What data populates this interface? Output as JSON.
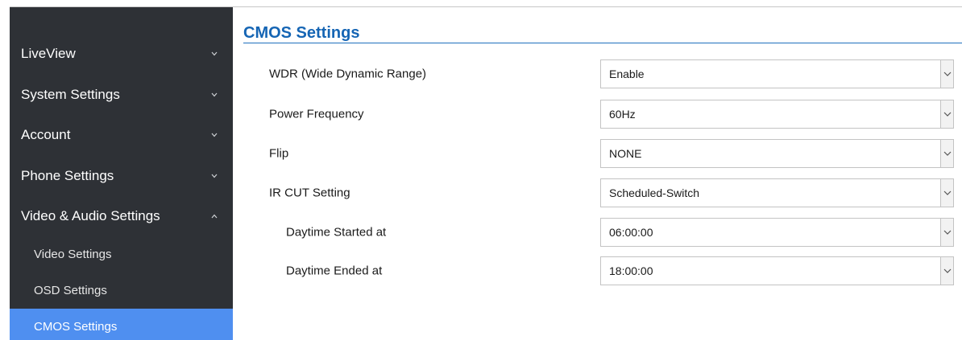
{
  "sidebar": {
    "items": [
      {
        "label": "LiveView",
        "expanded": false
      },
      {
        "label": "System Settings",
        "expanded": false
      },
      {
        "label": "Account",
        "expanded": false
      },
      {
        "label": "Phone Settings",
        "expanded": false
      },
      {
        "label": "Video & Audio Settings",
        "expanded": true
      }
    ],
    "sub_items": [
      {
        "label": "Video Settings"
      },
      {
        "label": "OSD Settings"
      },
      {
        "label": "CMOS Settings",
        "active": true
      }
    ]
  },
  "main": {
    "title": "CMOS Settings",
    "rows": [
      {
        "label": "WDR (Wide Dynamic Range)",
        "value": "Enable"
      },
      {
        "label": "Power Frequency",
        "value": "60Hz"
      },
      {
        "label": "Flip",
        "value": "NONE"
      },
      {
        "label": "IR CUT Setting",
        "value": "Scheduled-Switch"
      },
      {
        "label": "Daytime Started at",
        "value": "06:00:00"
      },
      {
        "label": "Daytime Ended at",
        "value": "18:00:00"
      }
    ]
  },
  "colors": {
    "sidebar_bg": "#2e3136",
    "active_bg": "#4f8ff0",
    "title_color": "#1565b4"
  },
  "icons": {
    "collapsed": "chevron-down-icon",
    "expanded": "chevron-up-icon",
    "select_arrow": "dropdown-arrow-icon"
  }
}
